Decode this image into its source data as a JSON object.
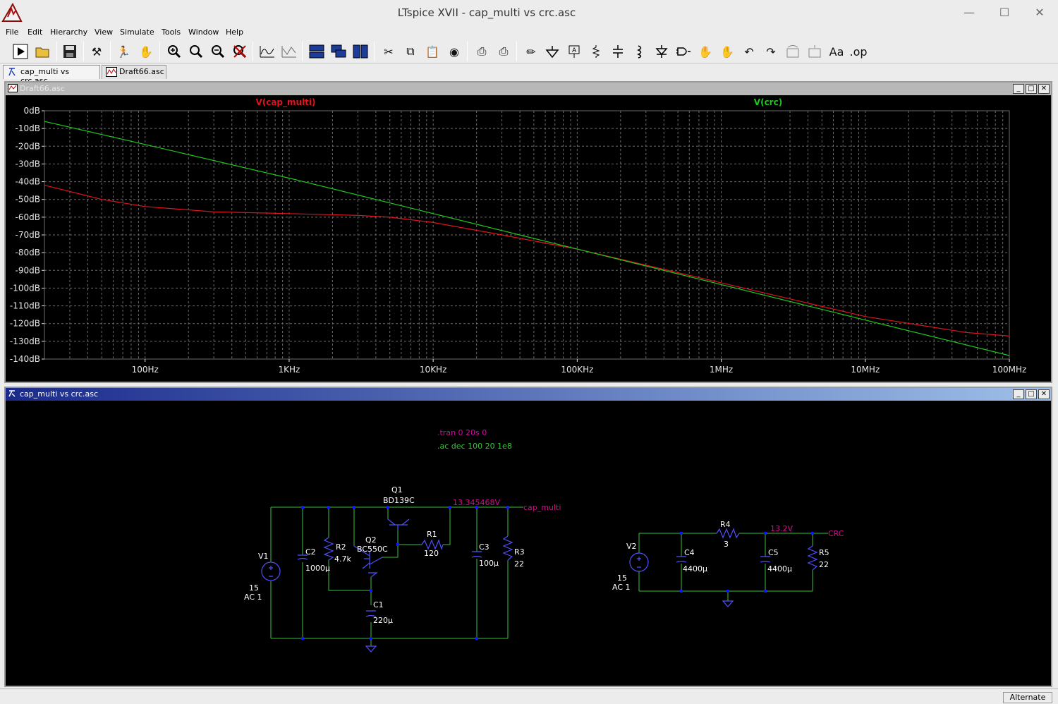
{
  "window": {
    "title": "LTspice XVII - cap_multi vs crc.asc"
  },
  "menu": [
    "File",
    "Edit",
    "Hierarchy",
    "View",
    "Simulate",
    "Tools",
    "Window",
    "Help"
  ],
  "toolbar": {
    "icons": [
      "run-icon",
      "open-icon",
      "save-icon",
      "control-panel-icon",
      "run-stop-icon",
      "pan-hand-icon",
      "zoom-in-icon",
      "zoom-fit-icon",
      "zoom-out-icon",
      "zoom-cancel-icon",
      "waveform-icon",
      "waveform-alt-icon",
      "tile-horizontal-icon",
      "cascade-icon",
      "tile-vertical-icon",
      "cut-icon",
      "copy-icon",
      "paste-icon",
      "find-icon",
      "print-icon",
      "print-setup-icon",
      "wire-icon",
      "ground-icon",
      "label-icon",
      "resistor-icon",
      "capacitor-icon",
      "inductor-icon",
      "diode-icon",
      "component-icon",
      "move-icon",
      "drag-icon",
      "undo-icon",
      "redo-icon",
      "rotate-icon",
      "mirror-icon",
      "text-icon",
      "spice-directive-icon"
    ]
  },
  "tabs": [
    {
      "label": "cap_multi vs crc.asc",
      "active": true
    },
    {
      "label": "Draft66.asc",
      "active": false
    }
  ],
  "plot_window": {
    "title": "Draft66.asc"
  },
  "schematic_window": {
    "title": "cap_multi vs crc.asc"
  },
  "colors": {
    "trace1": "#e0141e",
    "trace2": "#1ec81e",
    "wire": "#3cc03c",
    "directive": "#c8109c",
    "label_pink": "#d0108a",
    "component": "#5050ff",
    "node": "#1414ff",
    "grid": "#6c6c6c",
    "tick": "#e6e6e6"
  },
  "chart_data": {
    "type": "line",
    "xscale": "log",
    "xlim": [
      20,
      100000000
    ],
    "ylim": [
      -140,
      0
    ],
    "grid": true,
    "x_ticks": [
      "100Hz",
      "1KHz",
      "10KHz",
      "100KHz",
      "1MHz",
      "10MHz",
      "100MHz"
    ],
    "y_ticks": [
      "0dB",
      "-10dB",
      "-20dB",
      "-30dB",
      "-40dB",
      "-50dB",
      "-60dB",
      "-70dB",
      "-80dB",
      "-90dB",
      "-100dB",
      "-110dB",
      "-120dB",
      "-130dB",
      "-140dB"
    ],
    "series": [
      {
        "name": "V(cap_multi)",
        "color": "#e0141e",
        "x": [
          20,
          50,
          100,
          300,
          1000,
          3000,
          5000,
          10000,
          30000,
          100000,
          1000000,
          10000000,
          50000000,
          100000000
        ],
        "y": [
          -42,
          -50,
          -54,
          -57,
          -58,
          -59,
          -60,
          -63,
          -70,
          -78,
          -97,
          -116,
          -125,
          -127
        ]
      },
      {
        "name": "V(crc)",
        "color": "#1ec81e",
        "x": [
          20,
          100,
          1000,
          10000,
          100000,
          1000000,
          10000000,
          100000000
        ],
        "y": [
          -6,
          -19,
          -38,
          -58,
          -78,
          -98,
          -118,
          -138
        ]
      }
    ]
  },
  "schematic": {
    "directives": [
      ".tran 0 20s 0",
      ".ac dec 100 20 1e8"
    ],
    "circuit1": {
      "V1": {
        "ref": "V1",
        "value": "15",
        "ac": "AC 1"
      },
      "C2": {
        "ref": "C2",
        "value": "1000µ"
      },
      "R2": {
        "ref": "R2",
        "value": "4.7k"
      },
      "Q2": {
        "ref": "Q2",
        "value": "BC550C"
      },
      "Q1": {
        "ref": "Q1",
        "value": "BD139C"
      },
      "R1": {
        "ref": "R1",
        "value": "120"
      },
      "C3": {
        "ref": "C3",
        "value": "100µ"
      },
      "R3": {
        "ref": "R3",
        "value": "22"
      },
      "C1": {
        "ref": "C1",
        "value": "220µ"
      },
      "node_voltage": "13.345468V",
      "net_label": "cap_multi"
    },
    "circuit2": {
      "V2": {
        "ref": "V2",
        "value": "15",
        "ac": "AC 1"
      },
      "C4": {
        "ref": "C4",
        "value": "4400µ"
      },
      "R4": {
        "ref": "R4",
        "value": "3"
      },
      "C5": {
        "ref": "C5",
        "value": "4400µ"
      },
      "R5": {
        "ref": "R5",
        "value": "22"
      },
      "node_voltage": "13.2V",
      "net_label": "CRC"
    }
  },
  "status": {
    "mode": "Alternate"
  }
}
